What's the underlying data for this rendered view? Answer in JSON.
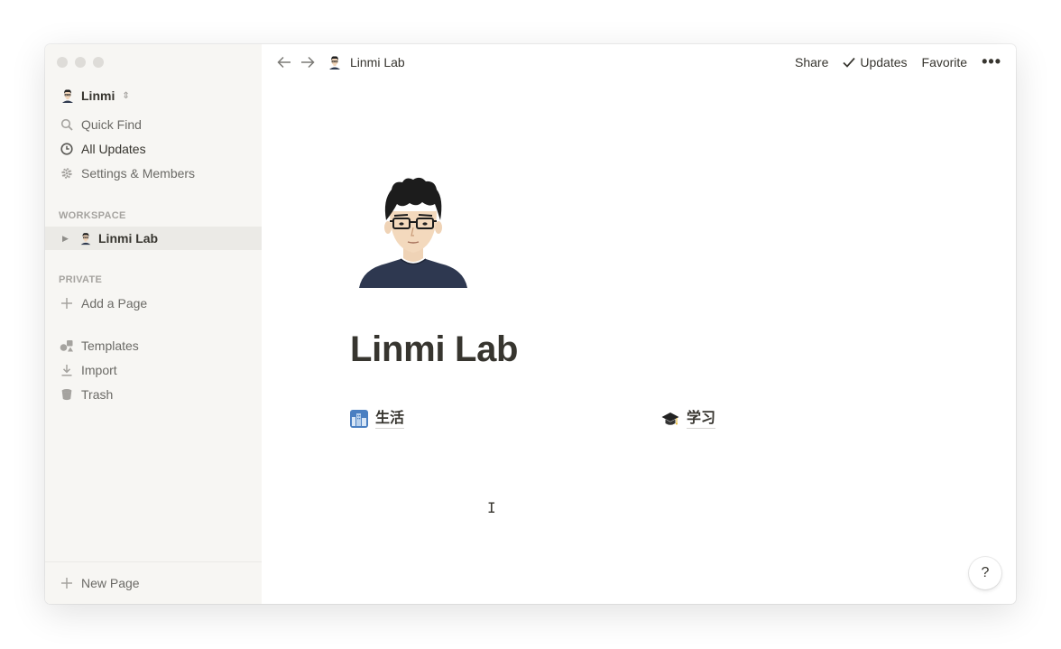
{
  "sidebar": {
    "workspace_name": "Linmi",
    "nav": {
      "quick_find": "Quick Find",
      "all_updates": "All Updates",
      "settings": "Settings & Members"
    },
    "workspace_label": "WORKSPACE",
    "workspace_page": "Linmi Lab",
    "private_label": "PRIVATE",
    "add_page": "Add a Page",
    "templates": "Templates",
    "import": "Import",
    "trash": "Trash",
    "new_page": "New Page"
  },
  "topbar": {
    "breadcrumb": "Linmi Lab",
    "share": "Share",
    "updates": "Updates",
    "favorite": "Favorite"
  },
  "page": {
    "title": "Linmi Lab",
    "subpages": [
      {
        "icon": "city-emoji",
        "label": "生活"
      },
      {
        "icon": "graduation-cap-emoji",
        "label": "学习"
      }
    ],
    "help": "?"
  },
  "colors": {
    "sidebar_bg": "#f7f6f3",
    "text": "#37352f",
    "muted": "#a5a39f",
    "selected_row": "#ebeae6"
  }
}
